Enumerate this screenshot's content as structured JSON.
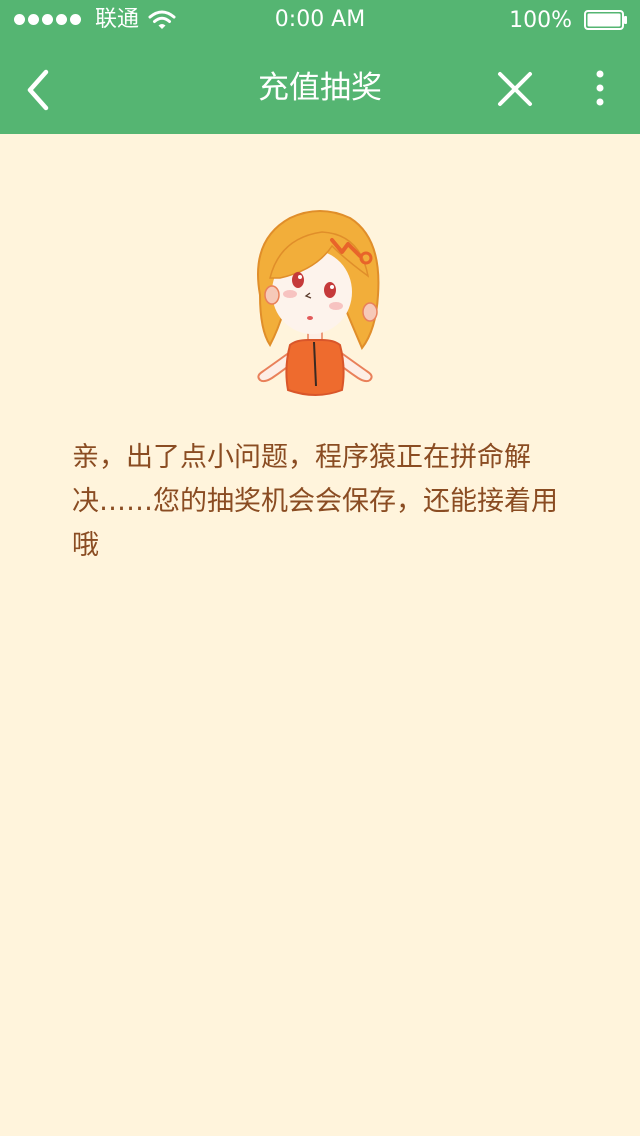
{
  "status_bar": {
    "carrier": "联通",
    "time": "0:00 AM",
    "battery_percent": "100%",
    "icons": [
      "signal-dots-icon",
      "wifi-icon",
      "battery-icon"
    ]
  },
  "nav": {
    "title": "充值抽奖",
    "back_icon": "chevron-left-icon",
    "close_icon": "close-icon",
    "more_icon": "more-vertical-icon"
  },
  "main": {
    "message": "亲，出了点小问题，程序猿正在拼命解决……您的抽奖机会会保存，还能接着用哦"
  },
  "colors": {
    "header": "#55B572",
    "background": "#FFF4DC",
    "message_text": "#8A4C22"
  }
}
